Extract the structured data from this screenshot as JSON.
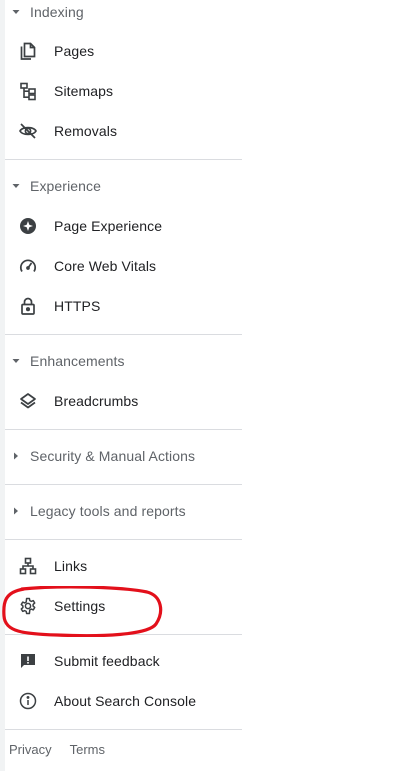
{
  "nav": {
    "indexing": {
      "header": "Indexing",
      "items": [
        {
          "label": "Pages",
          "icon": "pages-icon"
        },
        {
          "label": "Sitemaps",
          "icon": "sitemaps-icon"
        },
        {
          "label": "Removals",
          "icon": "removals-icon"
        }
      ]
    },
    "experience": {
      "header": "Experience",
      "items": [
        {
          "label": "Page Experience",
          "icon": "page-experience-icon"
        },
        {
          "label": "Core Web Vitals",
          "icon": "speedometer-icon"
        },
        {
          "label": "HTTPS",
          "icon": "lock-icon"
        }
      ]
    },
    "enhancements": {
      "header": "Enhancements",
      "items": [
        {
          "label": "Breadcrumbs",
          "icon": "layers-icon"
        }
      ]
    },
    "security": {
      "header": "Security & Manual Actions"
    },
    "legacy": {
      "header": "Legacy tools and reports"
    },
    "links": {
      "label": "Links",
      "icon": "links-icon"
    },
    "settings": {
      "label": "Settings",
      "icon": "gear-icon"
    },
    "submit_feedback": {
      "label": "Submit feedback",
      "icon": "feedback-icon"
    },
    "about": {
      "label": "About Search Console",
      "icon": "info-icon"
    }
  },
  "footer": {
    "privacy": "Privacy",
    "terms": "Terms"
  },
  "colors": {
    "icon": "#3c4043",
    "section_header": "#5f6368",
    "divider": "#dadce0",
    "annotation": "#e3101b"
  }
}
